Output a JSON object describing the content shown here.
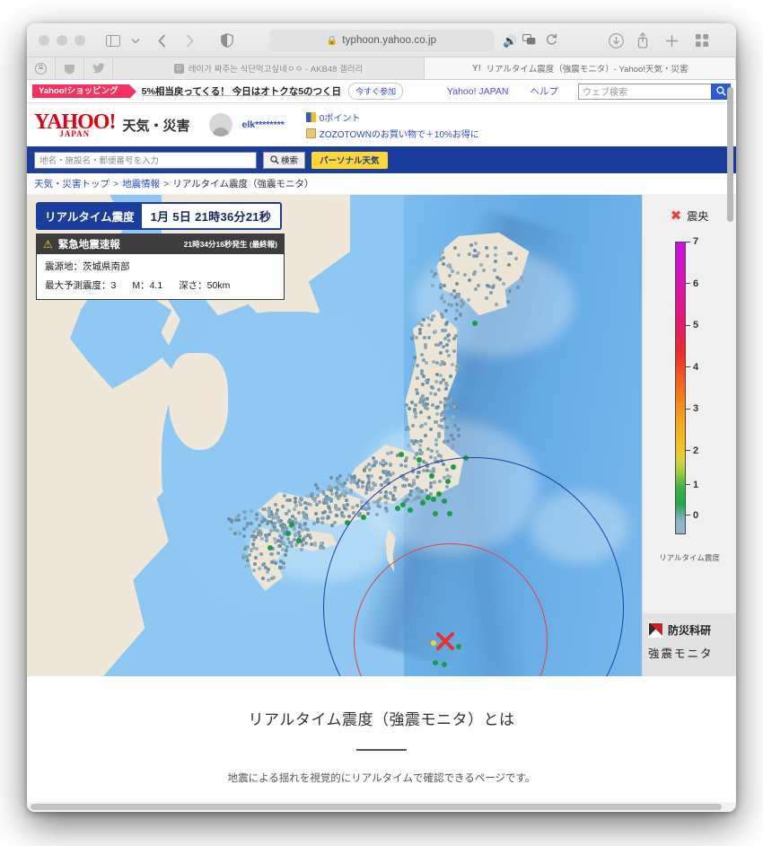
{
  "browser": {
    "url": "typhoon.yahoo.co.jp",
    "lock_icon": "lock-icon",
    "audio_icon": "audio-playing-icon",
    "translate_icon": "translate-icon",
    "reload_icon": "reload-icon",
    "back_icon": "back-chevron-icon",
    "forward_icon": "forward-chevron-icon",
    "sidebar_icon": "sidebar-toggle-icon",
    "shield_icon": "privacy-shield-icon",
    "download_icon": "download-icon",
    "share_icon": "share-icon",
    "newtab_icon": "new-tab-icon",
    "tabgrid_icon": "tab-overview-icon",
    "favorites": [
      "safari-icon",
      "pocket-icon",
      "twitter-icon"
    ],
    "tabs": [
      {
        "title": "레이가 짜주는 식단먹고싶네ㅇㅇ - AKB48 갤러리",
        "favicon": "dc-icon",
        "active": false
      },
      {
        "title": "リアルタイム震度（強震モニタ）- Yahoo!天気・災害",
        "favicon": "yahoo-icon",
        "active": true
      }
    ]
  },
  "promo": {
    "badge": "Yahoo!ショッピング",
    "text": "5%相当戻ってくる！ 今日はオトクな5のつく日",
    "cta": "今すぐ参加",
    "jp_link": "Yahoo! JAPAN",
    "help_link": "ヘルプ",
    "search_placeholder": "ウェブ検索",
    "search_icon": "search-icon"
  },
  "masthead": {
    "logo_main": "YAHOO!",
    "logo_sub": "JAPAN",
    "service": "天気・災害",
    "avatar_icon": "user-avatar-icon",
    "user_id": "elk********",
    "links": [
      {
        "icon": "point-icon",
        "label": "0ポイント"
      },
      {
        "icon": "zozotown-icon",
        "label": "ZOZOTOWNのお買い物で＋10%お得に"
      }
    ]
  },
  "searchbar": {
    "placeholder": "地名・施設名・郵便番号を入力",
    "value": "",
    "search_label": "検索",
    "search_icon": "search-icon",
    "personal_label": "パーソナル天気"
  },
  "breadcrumb": {
    "items": [
      "天気・災害トップ",
      "地震情報",
      "リアルタイム震度（強震モニタ）"
    ],
    "separator": ">"
  },
  "map": {
    "title_label": "リアルタイム震度",
    "timestamp": "1月  5日 21時36分21秒",
    "eew": {
      "warn_icon": "warning-triangle-icon",
      "title": "緊急地震速報",
      "time": "21時34分16秒発生 (最終報)",
      "epicenter_label": "震源地：茨城県南部",
      "intensity_label": "最大予測震度：3",
      "magnitude_label": "M：4.1",
      "depth_label": "深さ：50km"
    },
    "legend": {
      "epicenter_icon": "epicenter-x-icon",
      "epicenter_label": "震央",
      "scale_caption": "リアルタイム震度",
      "ticks": [
        "7",
        "6",
        "5",
        "4",
        "3",
        "2",
        "1",
        "0"
      ]
    },
    "nied": {
      "logo_icon": "nied-logo-icon",
      "name": "防災科研",
      "subtitle": "強震モニタ"
    },
    "colors": {
      "ocean": "#8dc7f2",
      "land": "#ece4d5",
      "s_wave_circle": "#1e3fb0",
      "p_wave_circle": "#e8413c",
      "epicenter": "#e8413c",
      "header_blue": "#1b3d9c"
    }
  },
  "article": {
    "title": "リアルタイム震度（強震モニタ）とは",
    "lead": "地震による揺れを視覚的にリアルタイムで確認できるページです。"
  }
}
